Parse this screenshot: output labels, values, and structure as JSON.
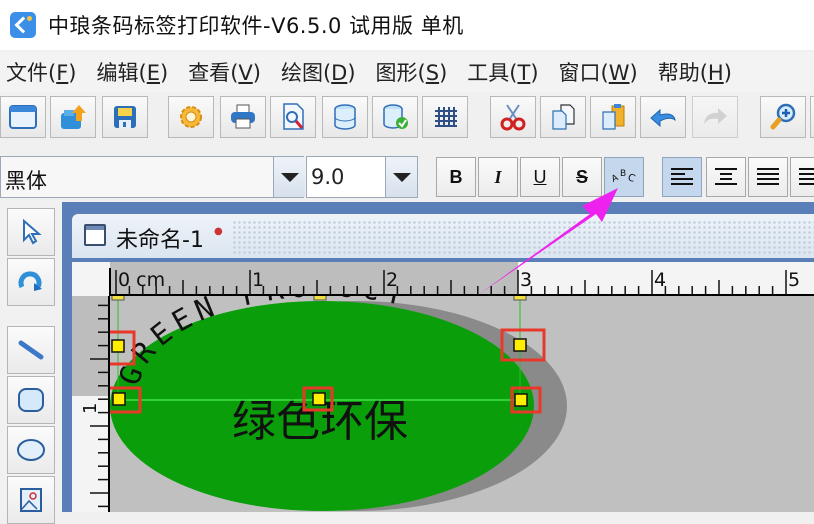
{
  "window": {
    "title": "中琅条码标签打印软件-V6.5.0 试用版 单机"
  },
  "menu": [
    {
      "label": "文件",
      "accel": "F"
    },
    {
      "label": "编辑",
      "accel": "E"
    },
    {
      "label": "查看",
      "accel": "V"
    },
    {
      "label": "绘图",
      "accel": "D"
    },
    {
      "label": "图形",
      "accel": "S"
    },
    {
      "label": "工具",
      "accel": "T"
    },
    {
      "label": "窗口",
      "accel": "W"
    },
    {
      "label": "帮助",
      "accel": "H"
    }
  ],
  "toolbar": {
    "buttons": [
      {
        "name": "new-document",
        "icon": "window-icon"
      },
      {
        "name": "open",
        "icon": "open-folder-icon"
      },
      {
        "name": "save",
        "icon": "floppy-disk-icon"
      },
      {
        "name": "settings",
        "icon": "gear-icon"
      },
      {
        "name": "print",
        "icon": "printer-icon"
      },
      {
        "name": "print-preview",
        "icon": "preview-magnifier-icon"
      },
      {
        "name": "database",
        "icon": "database-icon"
      },
      {
        "name": "database-settings",
        "icon": "database-check-icon"
      },
      {
        "name": "grid",
        "icon": "grid-icon"
      },
      {
        "name": "cut",
        "icon": "scissors-icon"
      },
      {
        "name": "copy",
        "icon": "copy-icon"
      },
      {
        "name": "paste",
        "icon": "paste-icon"
      },
      {
        "name": "undo",
        "icon": "undo-arrow-icon"
      },
      {
        "name": "redo",
        "icon": "redo-arrow-icon",
        "disabled": true
      },
      {
        "name": "zoom-in",
        "icon": "zoom-in-icon"
      }
    ]
  },
  "format_bar": {
    "font_family": "黑体",
    "font_size": "9.0",
    "bold_label": "B",
    "italic_label": "I",
    "underline_label": "U",
    "strike_label": "S",
    "arc_text_label": "ABC",
    "arc_text_active": true,
    "align_left_active": true
  },
  "toolbox": [
    {
      "name": "select",
      "icon": "pointer-arrow-icon"
    },
    {
      "name": "rotate",
      "icon": "rotate-icon"
    },
    {
      "name": "line",
      "icon": "line-icon"
    },
    {
      "name": "rounded-rect",
      "icon": "rounded-rectangle-icon"
    },
    {
      "name": "ellipse",
      "icon": "ellipse-icon"
    },
    {
      "name": "image",
      "icon": "image-icon"
    }
  ],
  "document": {
    "tab_title": "未命名-1",
    "ruler": {
      "unit": "cm",
      "top_labels": [
        "0 cm",
        "1",
        "2",
        "3",
        "4",
        "5"
      ],
      "left_labels": [
        "1"
      ]
    },
    "label": {
      "arc_text": "GREEN PRODUCT",
      "center_text": "绿色环保",
      "fill_color": "#0a9e0a",
      "shadow_color": "#8a8a8a"
    }
  },
  "annotation": {
    "arrow_color": "#ee22ee",
    "highlight_color": "#e8382a"
  }
}
